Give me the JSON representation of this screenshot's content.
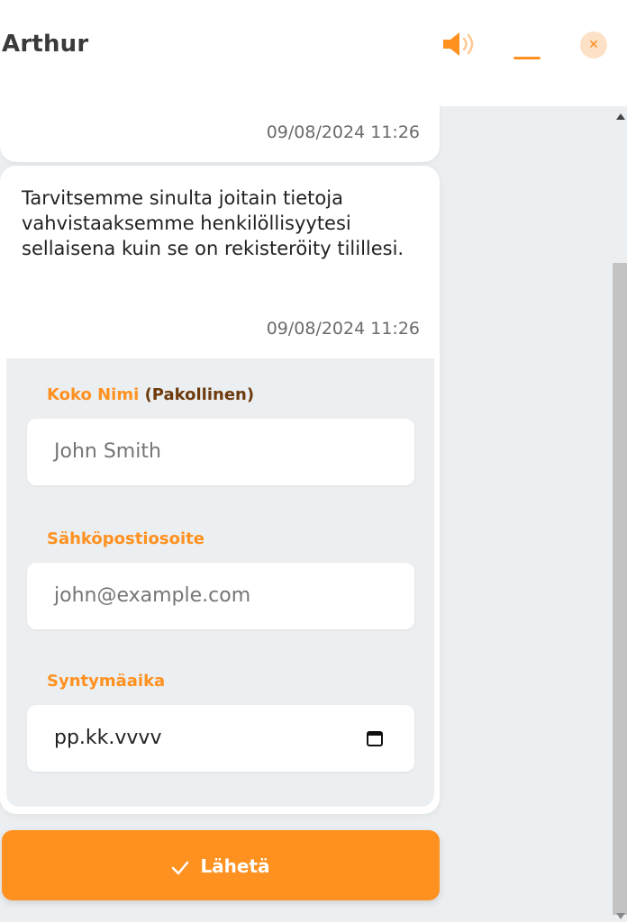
{
  "header": {
    "title": "Arthur",
    "icons": [
      "speaker-icon",
      "minimize-icon",
      "close-icon"
    ],
    "accent_color": "#ff9120"
  },
  "messages": [
    {
      "text": "",
      "timestamp": "09/08/2024 11:26"
    },
    {
      "text": "Tarvitsemme sinulta joitain tietoja vahvistaaksemme henkilöllisyytesi sellaisena kuin se on rekisteröity tilillesi.",
      "timestamp": "09/08/2024 11:26"
    }
  ],
  "form": {
    "name_label": "Koko Nimi",
    "name_required": "(Pakollinen)",
    "name_placeholder": "John Smith",
    "email_label": "Sähköpostiosoite",
    "email_placeholder": "john@example.com",
    "dob_label": "Syntymäaika",
    "dob_placeholder": "pp.kk.vvvv"
  },
  "submit": {
    "label": "Lähetä",
    "icon": "check-icon"
  }
}
